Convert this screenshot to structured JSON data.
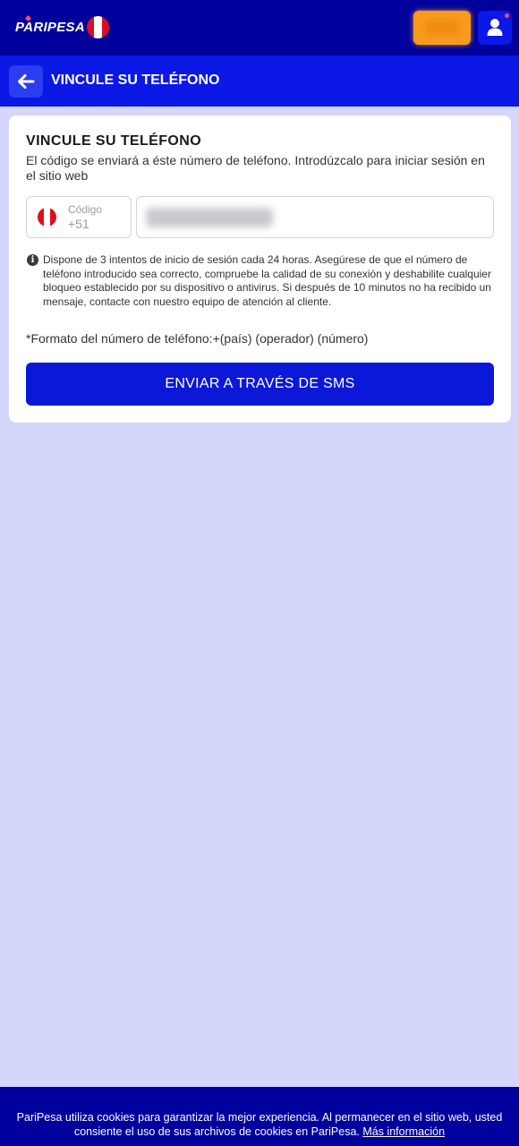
{
  "header": {
    "logo_text": "PARIPESA",
    "country_flag": "peru-flag",
    "user_icon": "user-icon",
    "colors": {
      "topbar": "#00009c",
      "login_button": "#f89a1c",
      "user_button": "#0b18e6"
    }
  },
  "subheader": {
    "back_icon": "arrow-left-icon",
    "title": "VINCULE SU TELÉFONO"
  },
  "card": {
    "title": "VINCULE SU TELÉFONO",
    "description": "El código se enviará a éste número de teléfono. Introdúzcalo para iniciar sesión en el sitio web",
    "code_field": {
      "label": "Código",
      "value": "+51",
      "flag": "peru-flag"
    },
    "phone_field": {
      "value": ""
    },
    "info_icon": "info-icon",
    "info_text": "Dispone de 3 intentos de inicio de sesión cada 24 horas. Asegúrese de que el número de teléfono introducido sea correcto, compruebe la calidad de su conexión y deshabilite cualquier bloqueo establecido por su dispositivo o antivirus. Si después de 10 minutos no ha recibido un mensaje, contacte con nuestro equipo de atención al cliente.",
    "format_text": "*Formato del número de teléfono:+(país) (operador) (número)",
    "submit_label": "ENVIAR A TRAVÉS DE SMS"
  },
  "cookie_bar": {
    "text": "PariPesa utiliza cookies para garantizar la mejor experiencia. Al permanecer en el sitio web, usted consiente el uso de sus archivos de cookies en PariPesa.",
    "link_label": "Más información"
  }
}
